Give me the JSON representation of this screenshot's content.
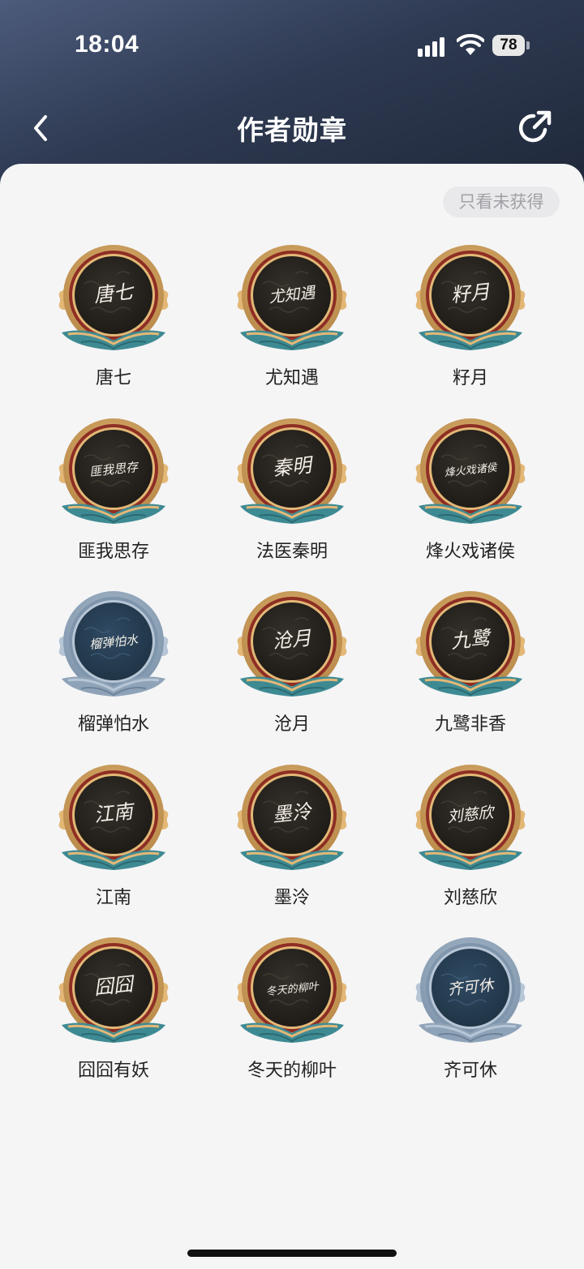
{
  "status_bar": {
    "time": "18:04",
    "battery": "78"
  },
  "nav": {
    "title": "作者勋章"
  },
  "filter": {
    "label": "只看未获得"
  },
  "medals": [
    {
      "name": "唐七",
      "tier": "gold",
      "signature": "唐七"
    },
    {
      "name": "尤知遇",
      "tier": "gold",
      "signature": "尤知遇"
    },
    {
      "name": "籽月",
      "tier": "gold",
      "signature": "籽月"
    },
    {
      "name": "匪我思存",
      "tier": "gold",
      "signature": "匪我思存"
    },
    {
      "name": "法医秦明",
      "tier": "gold",
      "signature": "秦明"
    },
    {
      "name": "烽火戏诸侯",
      "tier": "gold",
      "signature": "烽火戏诸侯"
    },
    {
      "name": "榴弹怕水",
      "tier": "silver",
      "signature": "榴弹怕水"
    },
    {
      "name": "沧月",
      "tier": "gold",
      "signature": "沧月"
    },
    {
      "name": "九鹭非香",
      "tier": "gold",
      "signature": "九鹭"
    },
    {
      "name": "江南",
      "tier": "gold",
      "signature": "江南"
    },
    {
      "name": "墨泠",
      "tier": "gold",
      "signature": "墨泠"
    },
    {
      "name": "刘慈欣",
      "tier": "gold",
      "signature": "刘慈欣"
    },
    {
      "name": "囧囧有妖",
      "tier": "gold",
      "signature": "囧囧"
    },
    {
      "name": "冬天的柳叶",
      "tier": "gold",
      "signature": "冬天的柳叶"
    },
    {
      "name": "齐可休",
      "tier": "silver",
      "signature": "齐可休"
    }
  ],
  "colors": {
    "gold_rim": "#e3b877",
    "gold_rim_dark": "#b98a4a",
    "gold_face": "#1d1a16",
    "red_ring": "#8e2e24",
    "teal_leaf": "#3e8a93",
    "silver_rim": "#b7c6d6",
    "silver_rim_dark": "#7f95ab",
    "silver_face": "#1f3344"
  }
}
